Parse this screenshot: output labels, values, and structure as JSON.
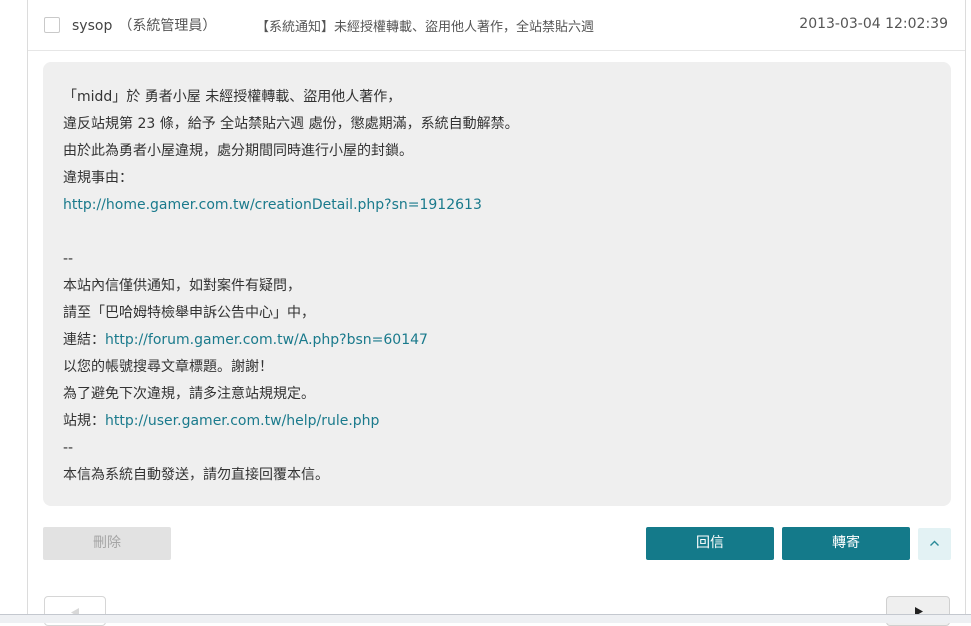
{
  "header": {
    "sender": "sysop",
    "sender_role": "（系統管理員）",
    "subject": "【系統通知】未經授權轉載、盜用他人著作，全站禁貼六週",
    "timestamp": "2013-03-04 12:02:39"
  },
  "message": {
    "lines": [
      {
        "text": "「midd」於 勇者小屋 未經授權轉載、盜用他人著作，"
      },
      {
        "text": "違反站規第 23 條，給予 全站禁貼六週 處份，懲處期滿，系統自動解禁。"
      },
      {
        "text": "由於此為勇者小屋違規，處分期間同時進行小屋的封鎖。"
      },
      {
        "text": "違規事由："
      },
      {
        "link": "http://home.gamer.com.tw/creationDetail.php?sn=1912613"
      },
      {
        "text": ""
      },
      {
        "text": "--"
      },
      {
        "text": "本站內信僅供通知，如對案件有疑問，"
      },
      {
        "text": "請至「巴哈姆特檢舉申訴公告中心」中，"
      },
      {
        "text": "連結：",
        "link": "http://forum.gamer.com.tw/A.php?bsn=60147"
      },
      {
        "text": "以您的帳號搜尋文章標題。謝謝！"
      },
      {
        "text": "為了避免下次違規，請多注意站規規定。"
      },
      {
        "text": "站規：",
        "link": "http://user.gamer.com.tw/help/rule.php"
      },
      {
        "text": "--"
      },
      {
        "text": "本信為系統自動發送，請勿直接回覆本信。"
      }
    ]
  },
  "actions": {
    "delete_label": "刪除",
    "reply_label": "回信",
    "forward_label": "轉寄"
  },
  "icons": {
    "scroll_top": "chevron-up-icon",
    "prev": "triangle-left-icon",
    "next": "triangle-right-icon"
  },
  "colors": {
    "accent": "#147a8a",
    "link": "#1a7a8c",
    "message_bg": "#efefef"
  }
}
